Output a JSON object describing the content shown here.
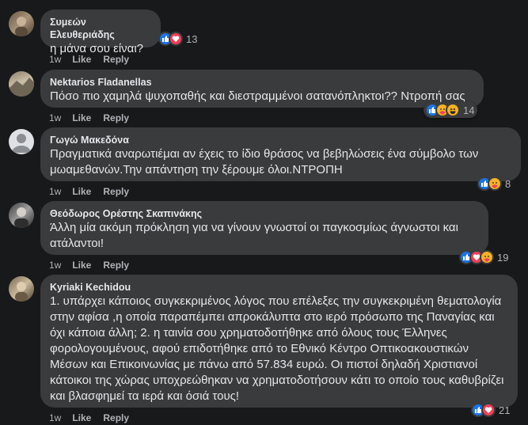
{
  "comments": [
    {
      "author": "Συμεών Ελευθεριάδης",
      "text": "η μάνα σου είναι?",
      "time": "1w",
      "like_label": "Like",
      "reply_label": "Reply",
      "reactions": [
        "like",
        "love"
      ],
      "reaction_count": "13"
    },
    {
      "author": "Nektarios Fladanellas",
      "text": "Πόσο πιο χαμηλά ψυχοπαθής και διεστραμμένοι σατανόπληκτοι?? Ντροπή σας",
      "time": "1w",
      "like_label": "Like",
      "reply_label": "Reply",
      "reactions": [
        "like",
        "care",
        "haha"
      ],
      "reaction_count": "14"
    },
    {
      "author": "Γωγώ Μακεδόνα",
      "text": "Πραγματικά αναρωτιέμαι αν έχεις το ίδιο θράσος να βεβηλώσεις ένα σύμβολο των μωαμεθανών.Την απάντηση την ξέρουμε όλοι.ΝΤΡΟΠΗ",
      "time": "1w",
      "like_label": "Like",
      "reply_label": "Reply",
      "reactions": [
        "like",
        "care"
      ],
      "reaction_count": "8"
    },
    {
      "author": "Θεόδωρος Ορέστης Σκαπινάκης",
      "text": "Άλλη μία ακόμη πρόκληση για να γίνουν γνωστοί οι παγκοσμίως άγνωστοι και ατάλαντοι!",
      "time": "1w",
      "like_label": "Like",
      "reply_label": "Reply",
      "reactions": [
        "like",
        "love",
        "care"
      ],
      "reaction_count": "19"
    },
    {
      "author": "Kyriaki Kechidou",
      "text": "1. υπάρχει κάποιος συγκεκριμένος λόγος που επέλεξες την συγκεκριμένη θεματολογία στην αφίσα ,η οποία παραπέμπει απροκάλυπτα στο ιερό πρόσωπο της Παναγίας και όχι κάποια άλλη; 2. η ταινία σου χρηματοδοτήθηκε από όλους τους Έλληνες φορολογουμένους, αφού επιδοτήθηκε από το Εθνικό Κέντρο Οπτικοακουστικών Μέσων και Επικοινωνίας με πάνω από 57.834 ευρώ. Οι πιστοί δηλαδή Χριστιανοί κάτοικοι της χώρας υποχρεώθηκαν να χρηματοδοτήσουν κάτι το οποίο τους καθυβρίζει και βλασφημεί τα ιερά και όσιά τους!",
      "time": "1w",
      "like_label": "Like",
      "reply_label": "Reply",
      "reactions": [
        "like",
        "love"
      ],
      "reaction_count": "21"
    }
  ],
  "colors": {
    "background": "#18191a",
    "bubble": "#3a3b3c",
    "text": "#e4e6eb",
    "secondary": "#b0b3b8",
    "like": "#1b74e4",
    "love": "#f33e58",
    "care": "#f7b125"
  }
}
